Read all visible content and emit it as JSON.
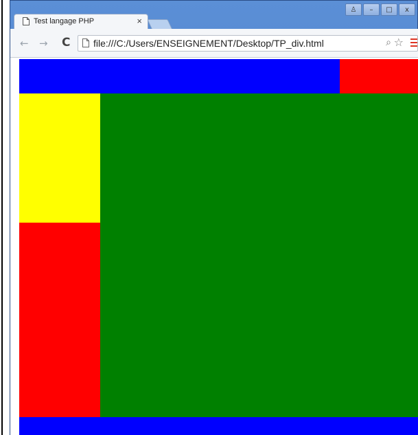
{
  "browser": {
    "tab_title": "Test langage PHP",
    "tab_close": "×",
    "url": "file:///C:/Users/ENSEIGNEMENT/Desktop/TP_div.html",
    "back_icon": "←",
    "forward_icon": "→",
    "reload_icon": "C",
    "zoom_icon": "⌕",
    "star_icon": "☆",
    "window_buttons": [
      "♙",
      "–",
      "□",
      "x"
    ]
  },
  "page": {
    "colors": {
      "blue": "#0000ff",
      "red": "#ff0000",
      "yellow": "#ffff00",
      "green": "#008000"
    }
  }
}
